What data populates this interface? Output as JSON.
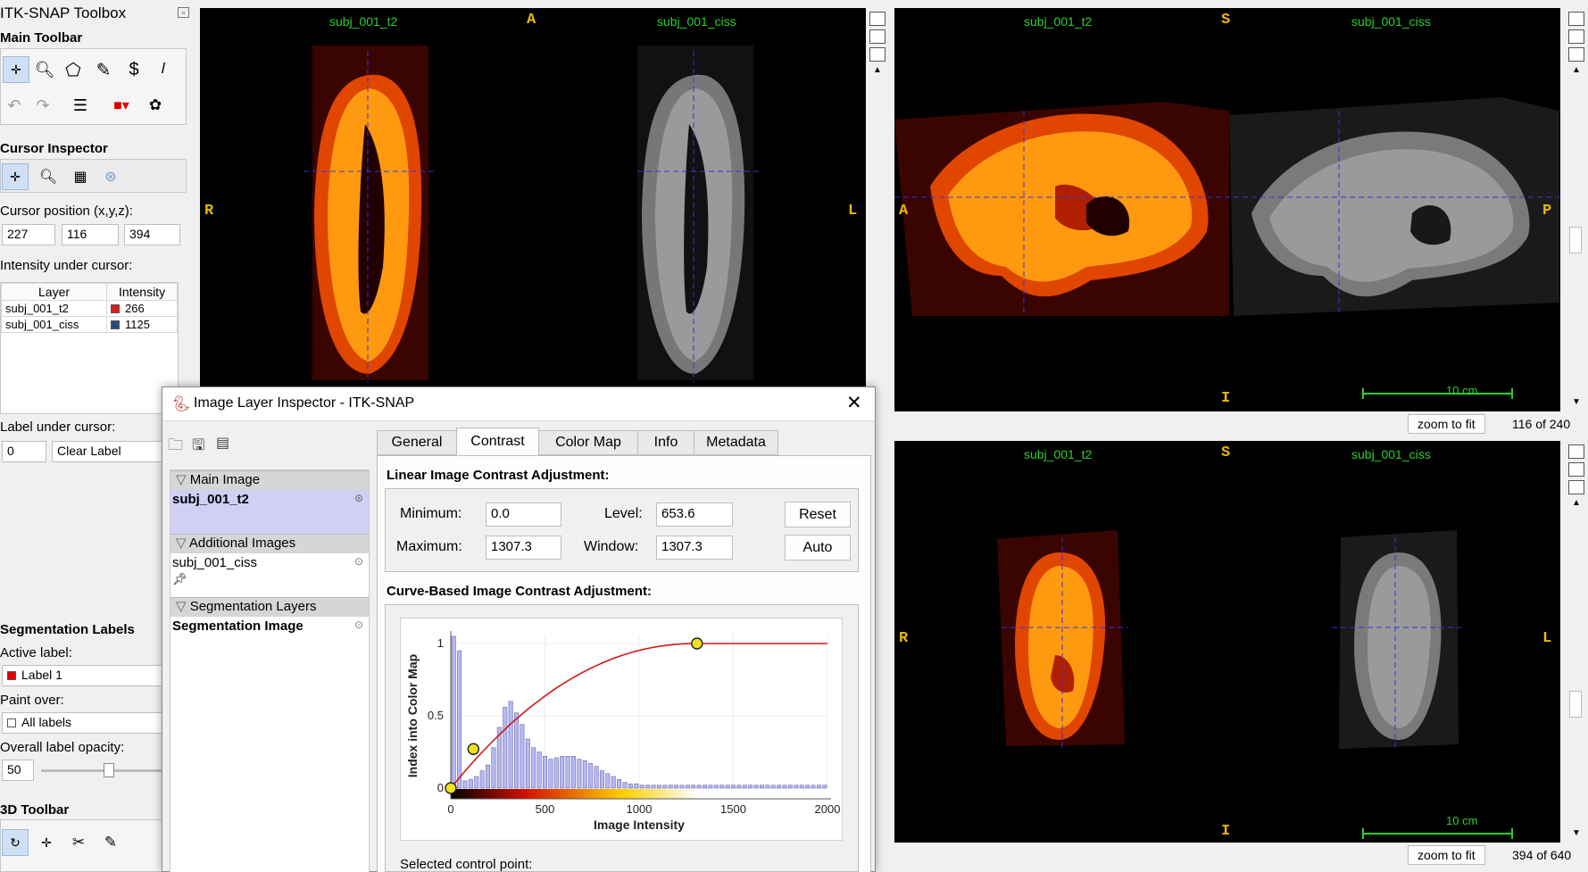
{
  "toolbox": {
    "title": "ITK-SNAP Toolbox",
    "main_toolbar": "Main Toolbar",
    "cursor_inspector": "Cursor Inspector",
    "cursor_position_label": "Cursor position (x,y,z):",
    "pos_x": "227",
    "pos_y": "116",
    "pos_z": "394",
    "intensity_label": "Intensity under cursor:",
    "col_layer": "Layer",
    "col_intensity": "Intensity",
    "rows": [
      {
        "layer": "subj_001_t2",
        "value": "266",
        "color": "#d42020"
      },
      {
        "layer": "subj_001_ciss",
        "value": "1125",
        "color": "#2a4b7c"
      }
    ],
    "label_under_cursor": "Label under cursor:",
    "label_id": "0",
    "label_name": "Clear Label",
    "seg_labels": "Segmentation Labels",
    "active_label": "Active label:",
    "active_value": "Label 1",
    "paint_over": "Paint over:",
    "paint_value": "All labels",
    "opacity_label": "Overall label opacity:",
    "opacity_value": "50",
    "toolbar3d": "3D Toolbar"
  },
  "views": {
    "axial": {
      "left_name": "subj_001_t2",
      "right_name": "subj_001_ciss",
      "top": "A",
      "left": "R",
      "right": "L"
    },
    "sagittal": {
      "left_name": "subj_001_t2",
      "right_name": "subj_001_ciss",
      "top": "S",
      "bottom": "I",
      "left": "A",
      "right": "P",
      "scale": "10 cm",
      "zoom": "zoom to fit",
      "slice": "116 of 240"
    },
    "coronal": {
      "left_name": "subj_001_t2",
      "right_name": "subj_001_ciss",
      "top": "S",
      "bottom": "I",
      "left": "R",
      "right": "L",
      "scale": "10 cm",
      "zoom": "zoom to fit",
      "slice": "394 of 640"
    }
  },
  "dialog": {
    "title": "Image Layer Inspector - ITK-SNAP",
    "tabs": [
      "General",
      "Contrast",
      "Color Map",
      "Info",
      "Metadata"
    ],
    "main_image_head": "Main Image",
    "main_image": "subj_001_t2",
    "additional_head": "Additional Images",
    "additional_image": "subj_001_ciss",
    "seg_head": "Segmentation Layers",
    "seg_image": "Segmentation Image",
    "linear_title": "Linear Image Contrast Adjustment:",
    "min_label": "Minimum:",
    "min_value": "0.0",
    "max_label": "Maximum:",
    "max_value": "1307.3",
    "level_label": "Level:",
    "level_value": "653.6",
    "window_label": "Window:",
    "window_value": "1307.3",
    "reset": "Reset",
    "auto": "Auto",
    "curve_title": "Curve-Based Image Contrast Adjustment:",
    "selected_cp": "Selected control point:"
  },
  "chart_data": {
    "type": "line",
    "xlabel": "Image Intensity",
    "ylabel": "Index into Color Map",
    "xlim": [
      0,
      2000
    ],
    "ylim": [
      0,
      1
    ],
    "xticks": [
      "0",
      "500",
      "1000",
      "1500",
      "2000"
    ],
    "yticks": [
      "0",
      "0.5",
      "1"
    ],
    "control_points": [
      [
        0,
        0
      ],
      [
        120,
        0.27
      ],
      [
        1307,
        1
      ]
    ],
    "curve_end": 2000,
    "histogram": [
      1.05,
      0.95,
      0.05,
      0.06,
      0.08,
      0.12,
      0.16,
      0.28,
      0.42,
      0.56,
      0.6,
      0.52,
      0.44,
      0.34,
      0.28,
      0.25,
      0.22,
      0.2,
      0.21,
      0.22,
      0.22,
      0.22,
      0.2,
      0.19,
      0.17,
      0.15,
      0.12,
      0.1,
      0.08,
      0.06,
      0.04,
      0.03,
      0.03,
      0.02,
      0.02,
      0.02,
      0.02,
      0.02,
      0.02,
      0.02,
      0.02,
      0.02,
      0.02,
      0.02,
      0.02,
      0.02,
      0.02,
      0.02,
      0.02,
      0.02,
      0.02,
      0.02,
      0.02,
      0.02,
      0.02,
      0.02,
      0.02,
      0.02,
      0.02,
      0.02,
      0.02,
      0.02,
      0.02,
      0.02,
      0.02,
      0.02
    ]
  }
}
